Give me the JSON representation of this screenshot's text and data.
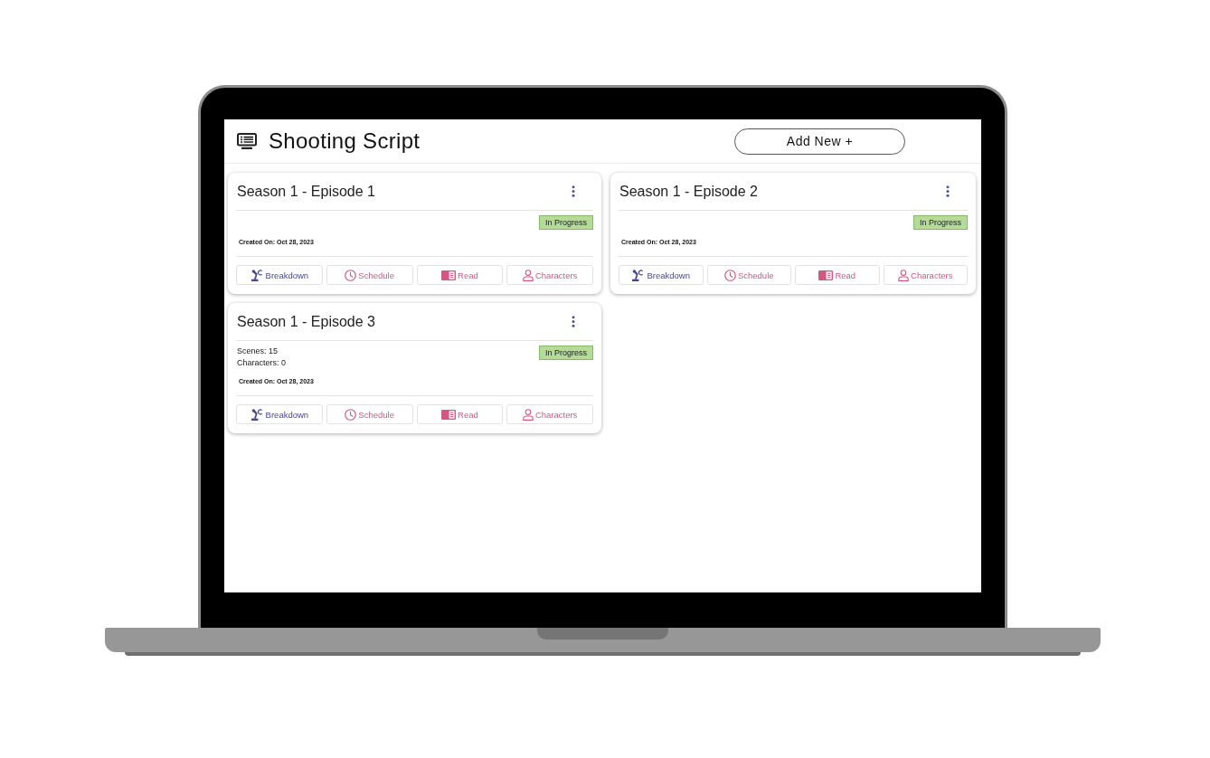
{
  "header": {
    "title": "Shooting Script",
    "add_button": "Add New +"
  },
  "episodes": [
    {
      "title": "Season 1 - Episode 1",
      "status": "In Progress",
      "created": "Created On: Oct 28, 2023",
      "actions": [
        {
          "kind": "breakdown",
          "label": "Breakdown"
        },
        {
          "kind": "schedule",
          "label": "Schedule"
        },
        {
          "kind": "read",
          "label": "Read"
        },
        {
          "kind": "characters",
          "label": "Characters"
        }
      ]
    },
    {
      "title": "Season 1 - Episode 2",
      "status": "In Progress",
      "created": "Created On: Oct 28, 2023",
      "actions": [
        {
          "kind": "breakdown",
          "label": "Breakdown"
        },
        {
          "kind": "schedule",
          "label": "Schedule"
        },
        {
          "kind": "read",
          "label": "Read"
        },
        {
          "kind": "characters",
          "label": "Characters"
        }
      ]
    },
    {
      "title": "Season 1 - Episode 3",
      "details": [
        "Scenes: 15",
        "Characters: 0"
      ],
      "status": "In Progress",
      "created": "Created On: Oct 28, 2023",
      "actions": [
        {
          "kind": "breakdown",
          "label": "Breakdown"
        },
        {
          "kind": "schedule",
          "label": "Schedule"
        },
        {
          "kind": "read",
          "label": "Read"
        },
        {
          "kind": "characters",
          "label": "Characters"
        }
      ]
    }
  ]
}
